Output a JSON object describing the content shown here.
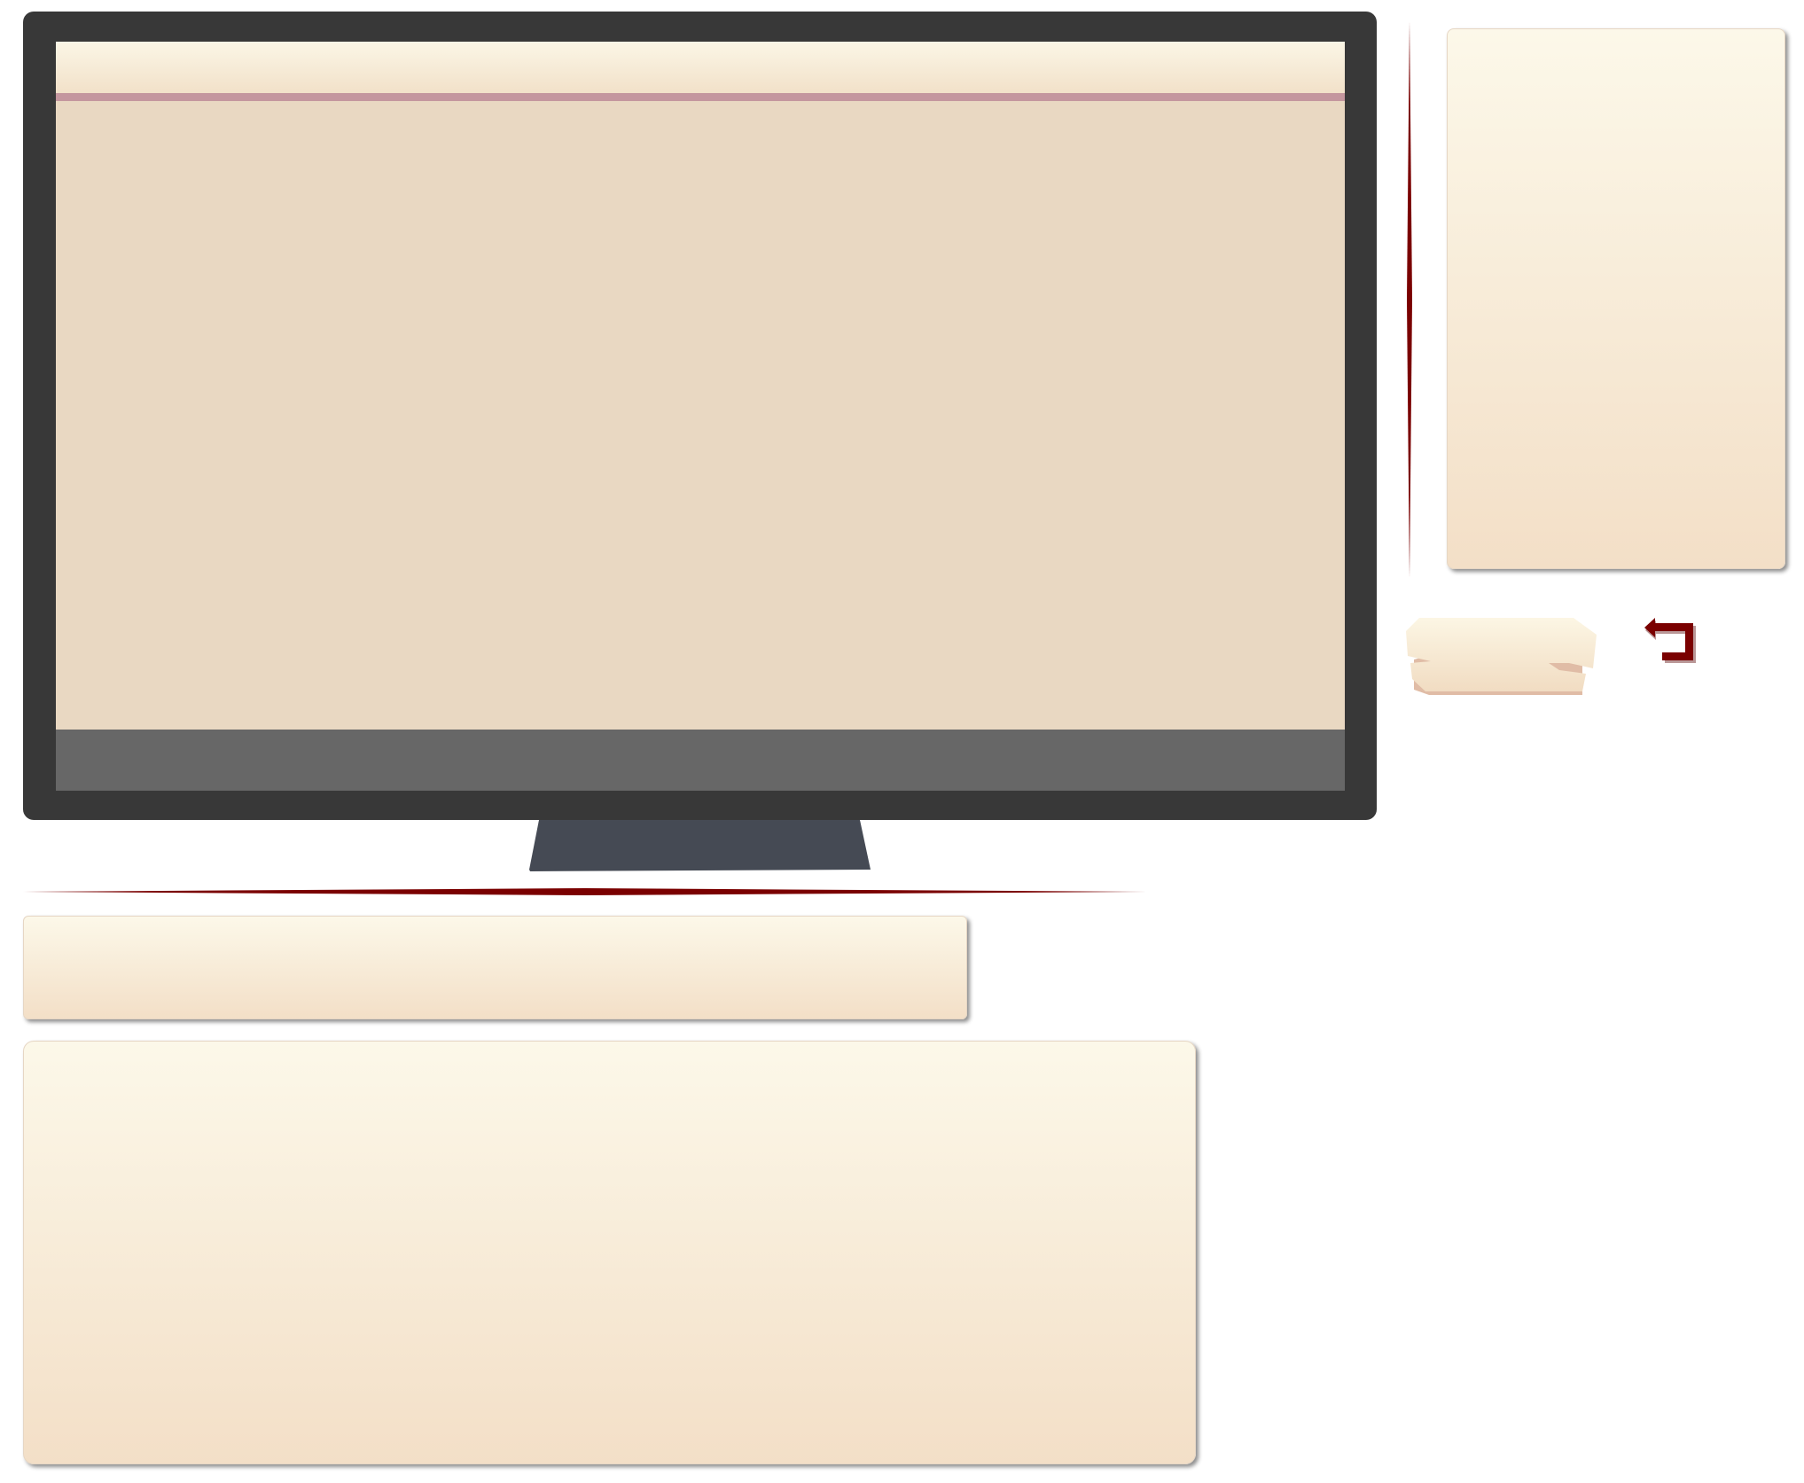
{
  "colors": {
    "monitor_bezel": "#383838",
    "screen_background": "#e9d8c2",
    "screen_header_line": "#c4969e",
    "screen_taskbar": "#676767",
    "monitor_stand": "#454a54",
    "accent_red": "#7a0000",
    "panel_gradient_top": "#fcf8e9",
    "panel_gradient_bottom": "#f3dfc7"
  },
  "icons": {
    "back": "return-arrow-icon"
  }
}
